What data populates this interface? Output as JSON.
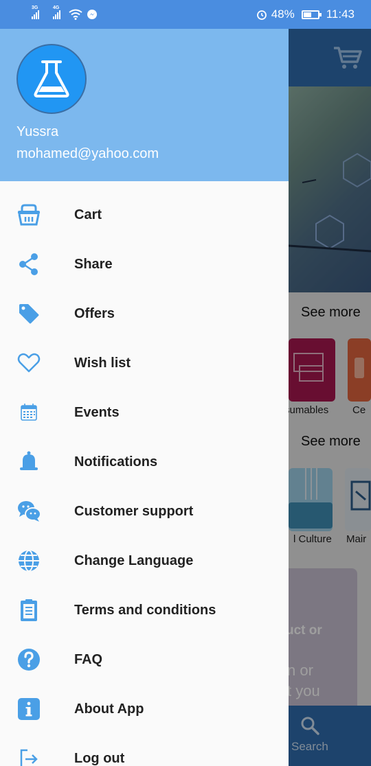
{
  "status_bar": {
    "net1": "3G",
    "net2": "4G",
    "battery": "48%",
    "battery_level": 0.48,
    "time": "11:43"
  },
  "drawer": {
    "user_name": "Yussra",
    "user_email": "mohamed@yahoo.com",
    "items": [
      {
        "label": "Cart",
        "icon": "basket-icon"
      },
      {
        "label": "Share",
        "icon": "share-icon"
      },
      {
        "label": "Offers",
        "icon": "tag-icon"
      },
      {
        "label": "Wish list",
        "icon": "heart-icon"
      },
      {
        "label": "Events",
        "icon": "calendar-icon"
      },
      {
        "label": "Notifications",
        "icon": "bell-icon"
      },
      {
        "label": "Customer support",
        "icon": "chat-icon"
      },
      {
        "label": "Change Language",
        "icon": "globe-icon"
      },
      {
        "label": "Terms and conditions",
        "icon": "clipboard-icon"
      },
      {
        "label": "FAQ",
        "icon": "question-icon"
      },
      {
        "label": "About App",
        "icon": "info-icon"
      },
      {
        "label": "Log out",
        "icon": "logout-icon"
      }
    ]
  },
  "background": {
    "see_more_1": "See more",
    "see_more_2": "See more",
    "tile_label_1": "sumables",
    "tile_label_2": "Ce",
    "tile_label_3": "l Culture",
    "tile_label_4": "Mair",
    "card_line_1": "uct or",
    "card_line_2": "n or",
    "card_line_3": "t you",
    "search_label": "Search"
  },
  "colors": {
    "status_bar": "#4a8de0",
    "drawer_header": "#7cb8ee",
    "icon_blue": "#4a9fe6",
    "app_primary": "#2f6daf"
  }
}
